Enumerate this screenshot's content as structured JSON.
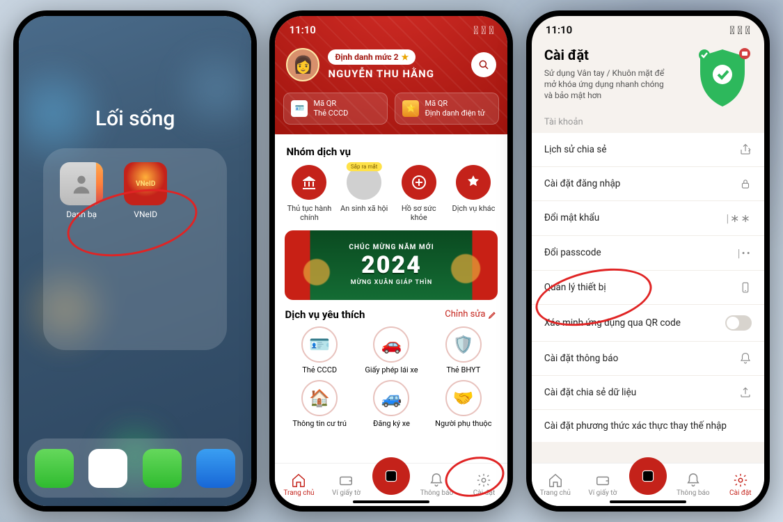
{
  "phone1": {
    "folder_title": "Lối sống",
    "apps": [
      {
        "label": "Danh bạ",
        "icon": "contacts"
      },
      {
        "label": "VNeID",
        "icon": "vneid"
      }
    ]
  },
  "phone2": {
    "status": {
      "time": "11:10"
    },
    "level_label": "Định danh mức 2",
    "user_name": "NGUYỄN THU HẰNG",
    "qr_cards": [
      {
        "line1": "Mã QR",
        "line2": "Thẻ CCCD"
      },
      {
        "line1": "Mã QR",
        "line2": "Định danh điện tử"
      }
    ],
    "section_services": "Nhóm dịch vụ",
    "services": [
      {
        "label": "Thủ tục hành chính"
      },
      {
        "label": "An sinh xã hội",
        "badge": "Sắp ra mắt"
      },
      {
        "label": "Hồ sơ sức khỏe"
      },
      {
        "label": "Dịch vụ khác"
      }
    ],
    "banner": {
      "t1": "CHÚC MỪNG NĂM MỚI",
      "t2": "2024",
      "t3": "MỪNG XUÂN GIÁP THÌN"
    },
    "section_fav": "Dịch vụ yêu thích",
    "edit_label": "Chỉnh sửa",
    "fav": [
      {
        "label": "Thẻ CCCD"
      },
      {
        "label": "Giấy phép lái xe"
      },
      {
        "label": "Thẻ BHYT"
      },
      {
        "label": "Thông tin cư trú"
      },
      {
        "label": "Đăng ký xe"
      },
      {
        "label": "Người phụ thuộc"
      }
    ],
    "tabs": [
      {
        "label": "Trang chủ"
      },
      {
        "label": "Ví giấy tờ"
      },
      {
        "label": ""
      },
      {
        "label": "Thông báo"
      },
      {
        "label": "Cài đặt"
      }
    ]
  },
  "phone3": {
    "status": {
      "time": "11:10"
    },
    "title": "Cài đặt",
    "subtitle": "Sử dụng Vân tay / Khuôn mặt để mở  khóa ứng dụng nhanh chóng và bảo mật hơn",
    "section_account": "Tài khoản",
    "rows": [
      {
        "label": "Lịch sử chia sẻ",
        "icon": "share"
      },
      {
        "label": "Cài đặt đăng nhập",
        "icon": "lock"
      },
      {
        "label": "Đổi mật khẩu",
        "icon": "dots-asterisk"
      },
      {
        "label": "Đổi passcode",
        "icon": "dots"
      },
      {
        "label": "Quản lý thiết bị",
        "icon": "phone"
      },
      {
        "label": "Xác minh ứng dụng qua QR code",
        "icon": "toggle"
      },
      {
        "label": "Cài đặt thông báo",
        "icon": "bell"
      },
      {
        "label": "Cài đặt chia sẻ dữ liệu",
        "icon": "upload"
      },
      {
        "label": "Cài đặt phương thức xác thực thay thế nhập",
        "icon": ""
      }
    ],
    "tabs": [
      {
        "label": "Trang chủ"
      },
      {
        "label": "Ví giấy tờ"
      },
      {
        "label": ""
      },
      {
        "label": "Thông báo"
      },
      {
        "label": "Cài đặt"
      }
    ]
  }
}
